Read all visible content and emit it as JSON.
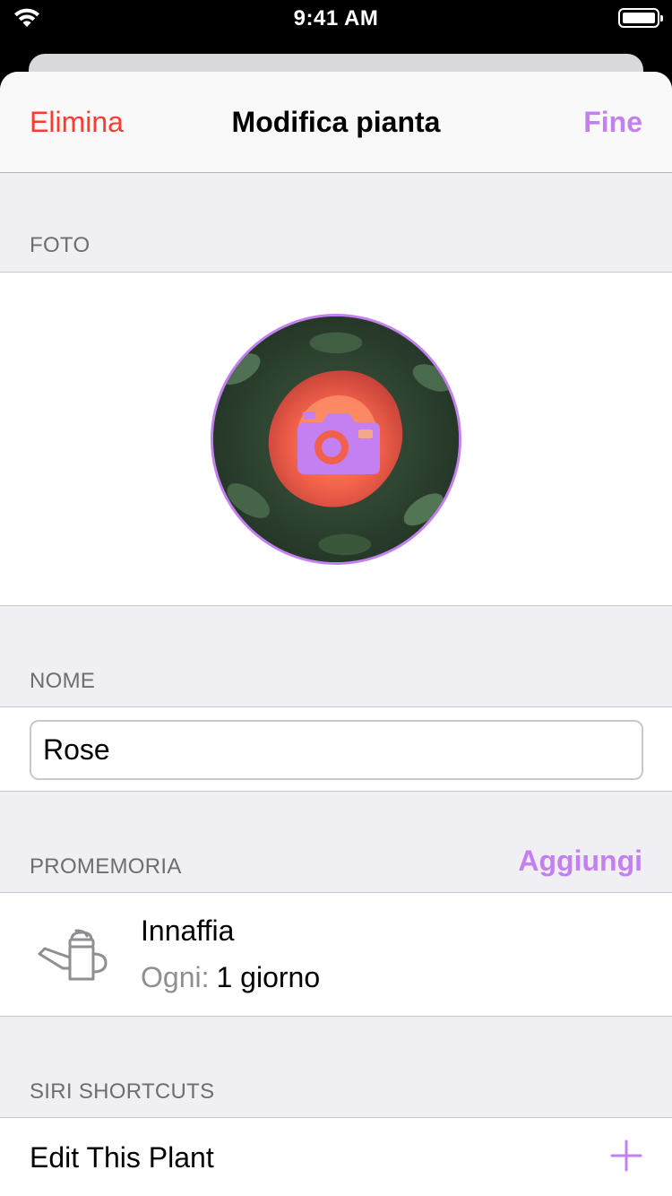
{
  "status_bar": {
    "time": "9:41 AM"
  },
  "navbar": {
    "left_label": "Elimina",
    "title": "Modifica pianta",
    "right_label": "Fine"
  },
  "photo_section": {
    "header": "FOTO",
    "camera_icon": "camera-icon"
  },
  "name_section": {
    "header": "NOME",
    "value": "Rose"
  },
  "reminders_section": {
    "header": "PROMEMORIA",
    "action_label": "Aggiungi",
    "items": [
      {
        "icon": "watering-can-icon",
        "title": "Innaffia",
        "interval_label": "Ogni:",
        "interval_value": "1 giorno"
      }
    ]
  },
  "siri_section": {
    "header": "SIRI SHORTCUTS",
    "items": [
      {
        "label": "Edit This Plant",
        "icon": "plus-icon"
      }
    ]
  },
  "colors": {
    "accent": "#c47ff0",
    "destructive": "#ff3b30",
    "background": "#efeff4"
  }
}
